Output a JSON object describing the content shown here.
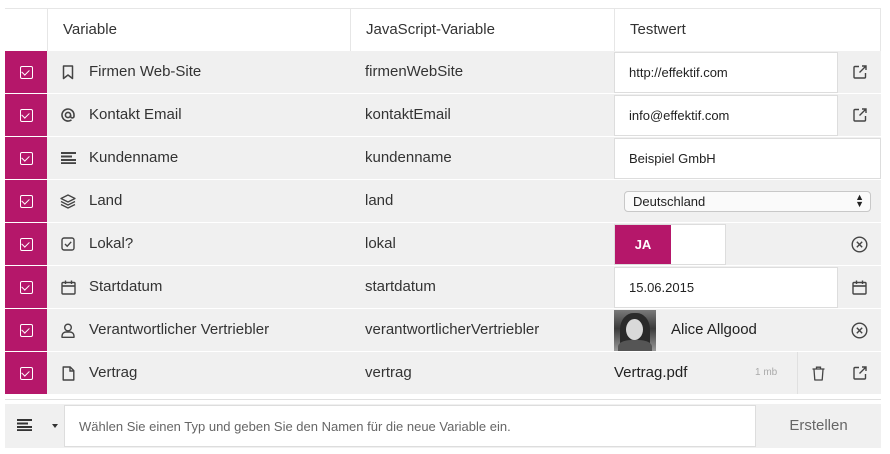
{
  "header": {
    "col_variable": "Variable",
    "col_js": "JavaScript-Variable",
    "col_test": "Testwert"
  },
  "rows": [
    {
      "icon": "bookmark-icon",
      "label": "Firmen Web-Site",
      "js": "firmenWebSite",
      "value": "http://effektif.com",
      "action": "external-link-icon"
    },
    {
      "icon": "at-sign-icon",
      "label": "Kontakt Email",
      "js": "kontaktEmail",
      "value": "info@effektif.com",
      "action": "external-link-icon"
    },
    {
      "icon": "text-lines-icon",
      "label": "Kundenname",
      "js": "kundenname",
      "value": "Beispiel GmbH"
    },
    {
      "icon": "layers-icon",
      "label": "Land",
      "js": "land",
      "value": "Deutschland"
    },
    {
      "icon": "checkbox-icon",
      "label": "Lokal?",
      "js": "lokal",
      "value": "JA",
      "action": "clear-icon"
    },
    {
      "icon": "calendar-icon",
      "label": "Startdatum",
      "js": "startdatum",
      "value": "15.06.2015",
      "action": "calendar-icon"
    },
    {
      "icon": "user-icon",
      "label": "Verantwortlicher Vertriebler",
      "js": "verantwortlicherVertriebler",
      "value": "Alice Allgood",
      "action": "clear-icon"
    },
    {
      "icon": "document-icon",
      "label": "Vertrag",
      "js": "vertrag",
      "value": "Vertrag.pdf",
      "size": "1 mb",
      "action": "external-link-icon"
    }
  ],
  "footer": {
    "placeholder": "Wählen Sie einen Typ und geben Sie den Namen für die neue Variable ein.",
    "button": "Erstellen"
  },
  "colors": {
    "accent": "#b5176a",
    "row_bg": "#f0f0f0"
  }
}
